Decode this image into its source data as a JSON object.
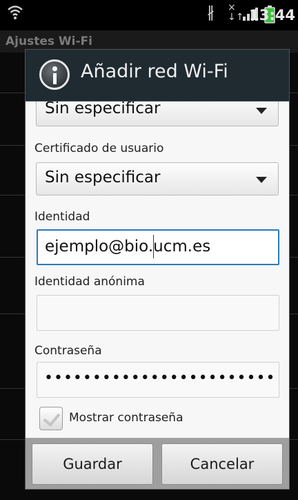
{
  "status_bar": {
    "time": "13:44",
    "icons": [
      "wifi-icon",
      "bluetooth-icon",
      "data-transfer-icon",
      "signal-icon",
      "battery-icon"
    ]
  },
  "background": {
    "title": "Ajustes Wi-Fi"
  },
  "dialog": {
    "title": "Añadir red Wi-Fi",
    "icon": "info-icon",
    "ca_certificate": {
      "value": "Sin especificar"
    },
    "user_certificate": {
      "label": "Certificado de usuario",
      "value": "Sin especificar"
    },
    "identity": {
      "label": "Identidad",
      "value": "ejemplo@bio.ucm.es"
    },
    "anonymous_identity": {
      "label": "Identidad anónima",
      "value": ""
    },
    "password": {
      "label": "Contraseña",
      "masked": "••••••••••••••••••••••••"
    },
    "show_password": {
      "label": "Mostrar contraseña",
      "checked": true
    },
    "buttons": {
      "save": "Guardar",
      "cancel": "Cancelar"
    }
  }
}
